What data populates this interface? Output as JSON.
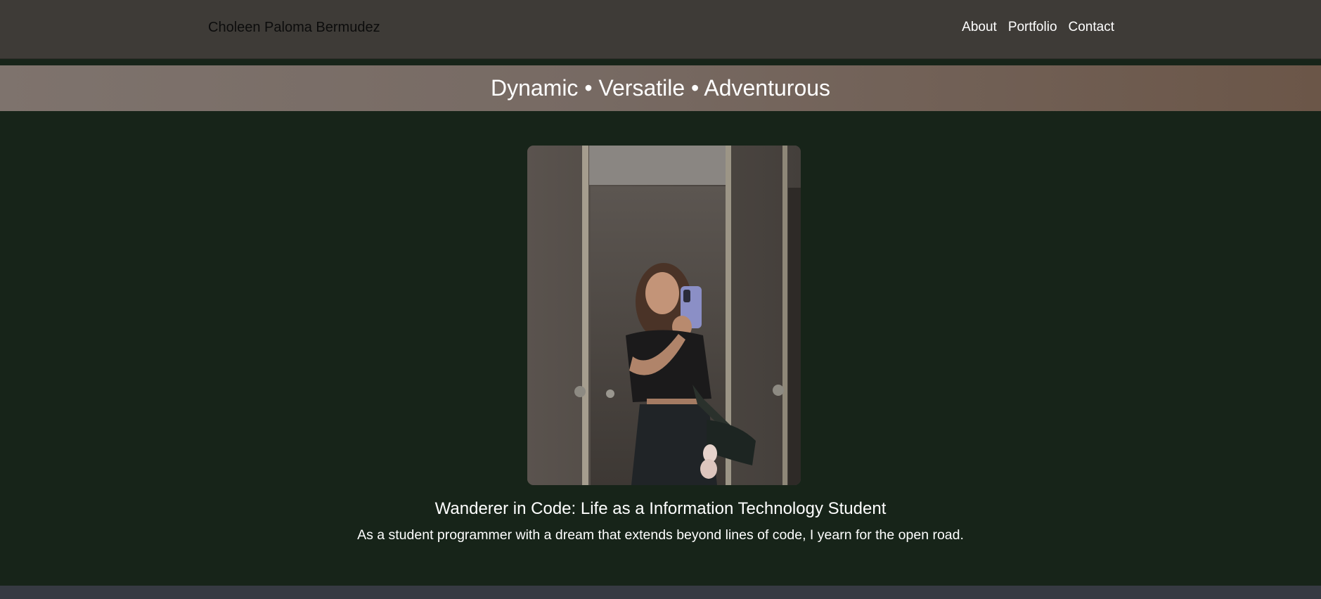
{
  "header": {
    "brand": "Choleen Paloma Bermudez",
    "nav": [
      {
        "label": "About"
      },
      {
        "label": "Portfolio"
      },
      {
        "label": "Contact"
      }
    ]
  },
  "banner": {
    "tagline": "Dynamic • Versatile • Adventurous"
  },
  "hero": {
    "photo_alt": "Mirror selfie photo",
    "headline": "Wanderer in Code: Life as a Information Technology Student",
    "intro": "As a student programmer with a dream that extends beyond lines of code, I yearn for the open road."
  },
  "colors": {
    "background": "#172419",
    "header": "#3e3b37",
    "footer": "#363a42",
    "banner_start": "#7e736d",
    "banner_end": "#6b5648"
  }
}
